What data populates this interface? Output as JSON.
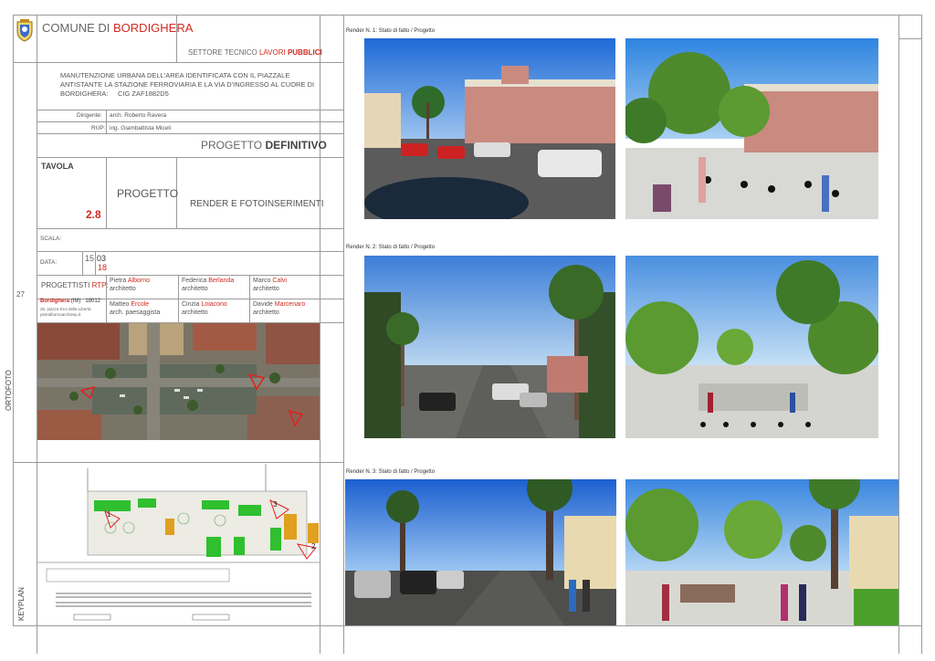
{
  "header": {
    "comune_prefix": "COMUNE DI",
    "comune_name": "BORDIGHERA",
    "settore_prefix": "SETTORE TECNICO",
    "settore_name": "LAVORI",
    "settore_bold": "PUBBLICI"
  },
  "project": {
    "description_line1": "MANUTENZIONE URBANA DELL'AREA IDENTIFICATA CON IL PIAZZALE",
    "description_line2": "ANTISTANTE LA STAZIONE FERROVIARIA E LA VIA D'INGRESSO AL CUORE DI",
    "description_line3": "BORDIGHERA:",
    "cig": "CIG ZAF1882D5",
    "dirigente_label": "Dirigente:",
    "dirigente_value": "arch. Roberto Ravera",
    "rup_label": "RUP:",
    "rup_value": "ing. Giambattista Miceli",
    "progetto_prefix": "PROGETTO",
    "progetto_type": "DEFINITIVO"
  },
  "tavola": {
    "label": "TAVOLA",
    "number": "2.8",
    "section": "PROGETTO",
    "title": "RENDER E FOTOINSERIMENTI"
  },
  "meta": {
    "scala_label": "SCALA:",
    "data_label": "DATA:",
    "day": "15",
    "month": "03",
    "year": "18",
    "page_number": "27"
  },
  "team": {
    "label_prefix": "PROGETTISTI",
    "label_rtp": "RTP:",
    "city": "Bordighera",
    "province": "(IM)",
    "cap": "18012",
    "address": "26, piazza Eroi della Libertà",
    "email": "pietralbornoarchiesp.it",
    "members": [
      {
        "first": "Pietra",
        "last": "Alborno",
        "role": "architetto"
      },
      {
        "first": "Federica",
        "last": "Berlanda",
        "role": "architetto"
      },
      {
        "first": "Marco",
        "last": "Calvi",
        "role": "architetto"
      },
      {
        "first": "Matteo",
        "last": "Ercole",
        "role": "arch. paesaggista"
      },
      {
        "first": "Cinzia",
        "last": "Loiacono",
        "role": "architetto"
      },
      {
        "first": "Davide",
        "last": "Marcenaro",
        "role": "architetto"
      }
    ]
  },
  "side_labels": {
    "ortofoto": "ORTOFOTO",
    "keyplan": "KEYPLAN"
  },
  "keyplan_markers": [
    "1",
    "2",
    "3"
  ],
  "renders": [
    {
      "caption": "Render N. 1: Stato di fatto / Progetto"
    },
    {
      "caption": "Render N. 2: Stato di fatto / Progetto"
    },
    {
      "caption": "Render N. 3: Stato di fatto / Progetto"
    }
  ],
  "colors": {
    "accent_red": "#d12a1f",
    "frame_gray": "#9a9a9a",
    "plan_green": "#2fbf2f",
    "plan_yellow": "#e0a020"
  }
}
